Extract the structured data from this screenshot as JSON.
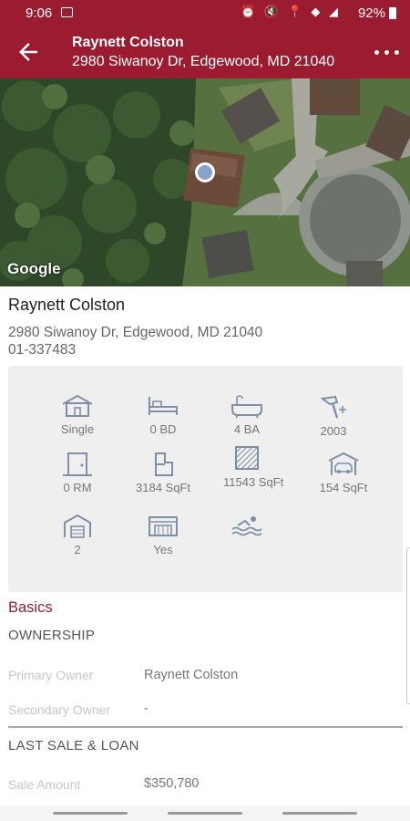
{
  "status_bar": {
    "time": "9:06",
    "battery": "92%",
    "icons": "⏰ 🔇 📍 ◆ ◢"
  },
  "header": {
    "title": "Raynett Colston",
    "subtitle": "2980 Siwanoy Dr, Edgewood, MD 21040"
  },
  "map": {
    "attribution": "Google"
  },
  "property": {
    "owner": "Raynett Colston",
    "address": "2980 Siwanoy Dr, Edgewood, MD 21040",
    "parcel": "01-337483"
  },
  "features": {
    "type": "Single",
    "bedrooms": "0 BD",
    "baths": "4 BA",
    "year_built": "2003",
    "rooms": "0 RM",
    "building_sqft": "3184 SqFt",
    "lot_sqft": "11543 SqFt",
    "garage_sqft": "154 SqFt",
    "stories": "2",
    "basement": "Yes"
  },
  "basics": {
    "title": "Basics",
    "ownership": {
      "heading": "OWNERSHIP",
      "primary_owner_label": "Primary Owner",
      "primary_owner_value": "Raynett Colston",
      "secondary_owner_label": "Secondary Owner",
      "secondary_owner_value": "-"
    },
    "last_sale": {
      "heading": "LAST SALE & LOAN",
      "sale_amount_label": "Sale Amount",
      "sale_amount_value": "$350,780"
    }
  },
  "colors": {
    "brand": "#9b1c31",
    "accent_text": "#8c2233",
    "icon": "#7f8fa6"
  },
  "icons": [
    "image-icon",
    "back-arrow-icon",
    "more-vert-icon",
    "house-icon",
    "bed-icon",
    "bathtub-icon",
    "hammer-icon",
    "door-icon",
    "floorplan-icon",
    "lot-icon",
    "garage-icon",
    "storage-icon",
    "basement-icon",
    "pool-icon",
    "location-dot-icon"
  ]
}
